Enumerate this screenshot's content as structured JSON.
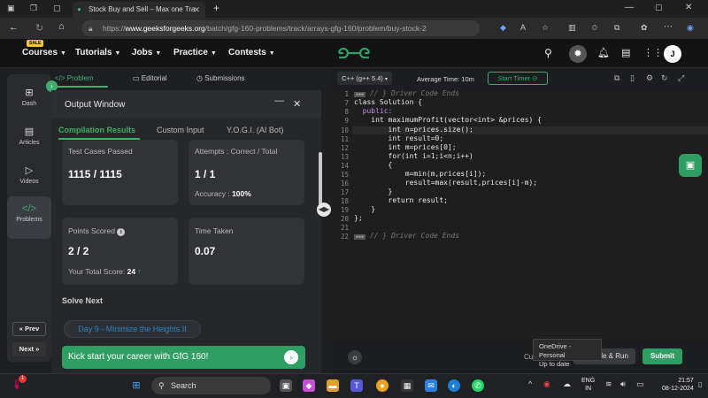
{
  "browser": {
    "tab_title": "Stock Buy and Sell – Max one Tra",
    "url_host": "www.geeksforgeeks.org",
    "url_path": "/batch/gfg-160-problems/track/arrays-gfg-160/problem/buy-stock-2",
    "url_prefix": "https://"
  },
  "sitenav": {
    "sale_badge": "SALE",
    "items": [
      "Courses",
      "Tutorials",
      "Jobs",
      "Practice",
      "Contests"
    ],
    "avatar": "J"
  },
  "leftrail": {
    "items": [
      {
        "label": "Dash",
        "icon": "dashboard-icon"
      },
      {
        "label": "Articles",
        "icon": "book-icon"
      },
      {
        "label": "Videos",
        "icon": "video-icon"
      },
      {
        "label": "Problems",
        "icon": "code-icon"
      }
    ],
    "prev": "Prev",
    "next": "Next"
  },
  "problem_tabs": [
    "Problem",
    "Editorial",
    "Submissions"
  ],
  "output": {
    "title": "Output Window",
    "tabs": [
      "Compilation Results",
      "Custom Input",
      "Y.O.G.I. (AI Bot)"
    ],
    "test_cases_label": "Test Cases Passed",
    "test_cases_value": "1115 / 1115",
    "attempts_label": "Attempts : Correct / Total",
    "attempts_value": "1 / 1",
    "accuracy_label": "Accuracy :",
    "accuracy_value": "100%",
    "points_label": "Points Scored",
    "points_value": "2 / 2",
    "total_score_label": "Your Total Score:",
    "total_score_value": "24",
    "time_label": "Time Taken",
    "time_value": "0.07",
    "solve_next": "Solve Next",
    "next_problem": "Day 9 - Minimize the Heights II",
    "banner": "Kick start your career with GfG 160!"
  },
  "editor": {
    "language": "C++ (g++ 5.4)",
    "avg_time": "Average Time: 10m",
    "timer": "Start Timer",
    "line_numbers": [
      "1",
      "7",
      "8",
      "9",
      "10",
      "11",
      "12",
      "13",
      "14",
      "15",
      "16",
      "17",
      "18",
      "19",
      "20",
      "21",
      "22"
    ],
    "code_lines": [
      "// } Driver Code Ends",
      "class Solution {",
      "  public:",
      "    int maximumProfit(vector<int> &prices) {",
      "        int n=prices.size();",
      "        int result=0;",
      "        int m=prices[0];",
      "        for(int i=1;i<n;i++)",
      "        {",
      "            m=min(m,prices[i]);",
      "            result=max(result,prices[i]-m);",
      "        }",
      "        return result;",
      "    }",
      "};",
      "",
      "// } Driver Code Ends"
    ],
    "custom_input_partial": "Cus",
    "compile_button": "Compile & Run",
    "submit_button": "Submit",
    "tooltip_line1": "OneDrive - Personal",
    "tooltip_line2": "Up to date"
  },
  "taskbar": {
    "search": "Search",
    "lang_line1": "ENG",
    "lang_line2": "IN",
    "time": "21:57",
    "date": "08-12-2024",
    "notification_count": "1"
  }
}
